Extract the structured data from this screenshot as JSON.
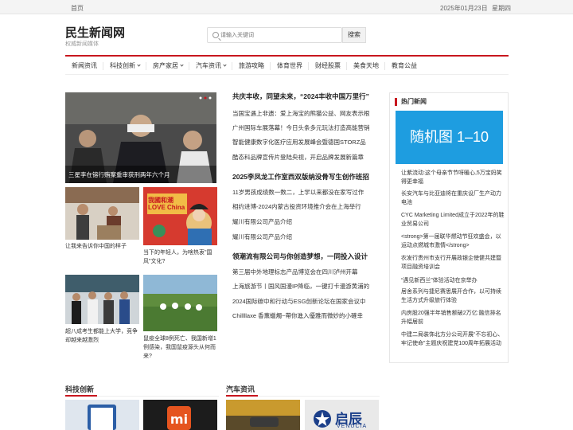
{
  "topbar": {
    "home": "首页",
    "date": "2025年01月23日",
    "week": "星期四"
  },
  "site": {
    "logo": "民生新闻网",
    "slogan": "权威新闻媒体"
  },
  "search": {
    "placeholder": "请输入关键词",
    "button": "搜索"
  },
  "nav": [
    {
      "label": "新闻资讯",
      "dd": false
    },
    {
      "label": "科技创新",
      "dd": true
    },
    {
      "label": "房产家居",
      "dd": true
    },
    {
      "label": "汽车资讯",
      "dd": true
    },
    {
      "label": "旅游攻略",
      "dd": false
    },
    {
      "label": "体育世界",
      "dd": false
    },
    {
      "label": "财经股票",
      "dd": false
    },
    {
      "label": "美食天地",
      "dd": false
    },
    {
      "label": "教育公益",
      "dd": false
    }
  ],
  "slider": {
    "caption": "三星李在镕行贿案重审获刑两年六个月"
  },
  "cards": [
    {
      "caption": "让我来告诉你中国的样子"
    },
    {
      "caption": "当下的年轻人，为啥热衷\"国风\"文化?",
      "image_text": "我國和潮LOVE China"
    },
    {
      "caption": "超八成考生都能上大学，竞争却越来越激烈"
    },
    {
      "caption": "鼠疫全球8例死亡、我国新增1例感染，我国鼠疫源头从何而来?"
    }
  ],
  "blocks": [
    {
      "headline": "共庆丰收，同望未来，“2024丰收中国万里行”",
      "items": [
        "当国宝遇上非遗：爱上海宝的熊猫公益、网友表示根",
        "广州国际车展落幕！今日头条多元玩法打造高能营销",
        "智能健康数字化医疗应用发展峰会暨德国STORZ品",
        "酷态科品牌宣传片登陆央视，开启品牌发展新篇章"
      ]
    },
    {
      "headline": "2025李凤龙工作室西双版纳没骨写生创作班招",
      "items": [
        "11岁男孩成绩数一数二，上学以来都没在家写过作",
        "相约进博-2024内蒙古投资环境推介会在上海举行",
        "耀川有限公司产品介绍",
        "耀川有限公司产品介绍"
      ]
    },
    {
      "headline": "领潮流有限公司与你创造梦想，一同投入设计",
      "items": [
        "第三届中外地理标志产品博览会在四川泸州开幕",
        "上海旅游节丨国风国漫IP降临，一键打卡漫游黄浦的",
        "2024国际碳中和行动与ESG创新论坛在国家会议中",
        "Chillllaxe 香薰蠟燭~帶你進入優雅而微妙的小確幸"
      ]
    }
  ],
  "sidebar": {
    "title": "热门新闻",
    "ad_text": "随机图 1–10",
    "items": [
      "让紫流动:这个母亲节节呀暖心,5万宝妈笑得更幸福",
      "长安汽车与比亚迪将在重庆设厂生产动力电池",
      "CYC Marketing Limited成立于2022年的鞋业贸易公司",
      "<strong>第一届联华燃动节狂欢盛会，以运动点燃城市激情</strong>",
      "农发行贵州市支行开展政银企使健共建暨项目融资培训会",
      "“遇见新西兰”体验活动在京举办",
      "居舍系列与捷尼赛思展开合作，以可持续生活方式升级旅行体验",
      "内房股20强半年销售额破2万亿:融信排名升幅居前",
      "中建二局装饰北方分公司开展“不忘初心、牢记使命”主题庆祝建党100周年拓展活动"
    ]
  },
  "sections": [
    {
      "title": "科技创新"
    },
    {
      "title": "汽车资讯"
    }
  ],
  "bottom_thumbs": {
    "logo_text": "启辰",
    "logo_sub": "VENUCIA"
  }
}
